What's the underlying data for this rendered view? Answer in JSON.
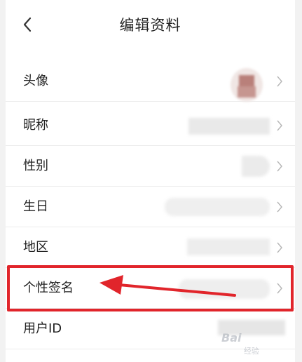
{
  "header": {
    "title": "编辑资料"
  },
  "rows": [
    {
      "label": "头像"
    },
    {
      "label": "昵称"
    },
    {
      "label": "性别"
    },
    {
      "label": "生日"
    },
    {
      "label": "地区"
    },
    {
      "label": "个性签名"
    },
    {
      "label": "用户ID"
    }
  ],
  "colors": {
    "highlight": "#e1252b",
    "arrow": "#e1252b",
    "text": "#222222",
    "divider": "#ececec"
  },
  "watermark": {
    "text": "Bai",
    "sub": "经验"
  },
  "icons": {
    "back": "chevron-left-icon",
    "row": "chevron-right-icon"
  }
}
